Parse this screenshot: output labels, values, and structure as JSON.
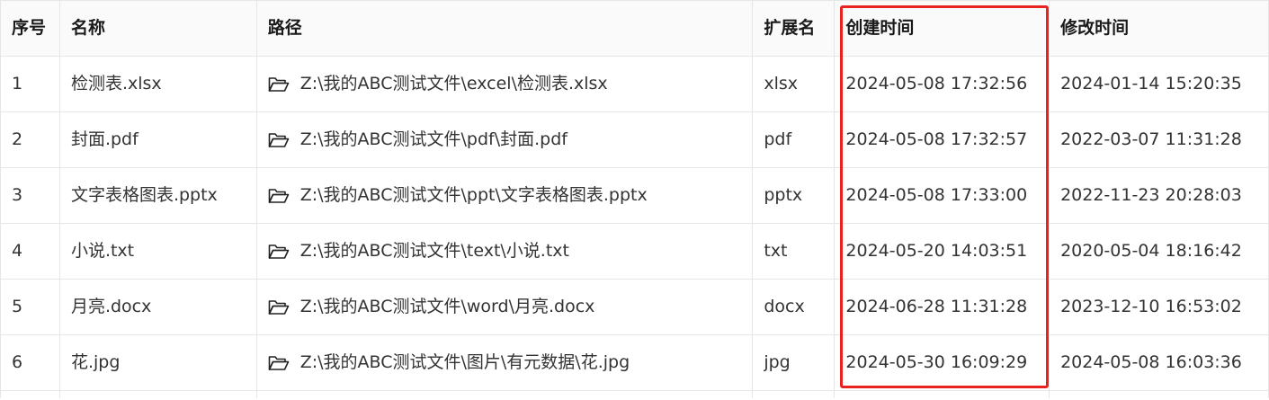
{
  "table": {
    "headers": {
      "index": "序号",
      "name": "名称",
      "path": "路径",
      "ext": "扩展名",
      "created": "创建时间",
      "modified": "修改时间"
    },
    "rows": [
      {
        "index": "1",
        "name": "检测表.xlsx",
        "path": "Z:\\我的ABC测试文件\\excel\\检测表.xlsx",
        "ext": "xlsx",
        "created": "2024-05-08 17:32:56",
        "modified": "2024-01-14 15:20:35"
      },
      {
        "index": "2",
        "name": "封面.pdf",
        "path": "Z:\\我的ABC测试文件\\pdf\\封面.pdf",
        "ext": "pdf",
        "created": "2024-05-08 17:32:57",
        "modified": "2022-03-07 11:31:28"
      },
      {
        "index": "3",
        "name": "文字表格图表.pptx",
        "path": "Z:\\我的ABC测试文件\\ppt\\文字表格图表.pptx",
        "ext": "pptx",
        "created": "2024-05-08 17:33:00",
        "modified": "2022-11-23 20:28:03"
      },
      {
        "index": "4",
        "name": "小说.txt",
        "path": "Z:\\我的ABC测试文件\\text\\小说.txt",
        "ext": "txt",
        "created": "2024-05-20 14:03:51",
        "modified": "2020-05-04 18:16:42"
      },
      {
        "index": "5",
        "name": "月亮.docx",
        "path": "Z:\\我的ABC测试文件\\word\\月亮.docx",
        "ext": "docx",
        "created": "2024-06-28 11:31:28",
        "modified": "2023-12-10 16:53:02"
      },
      {
        "index": "6",
        "name": "花.jpg",
        "path": "Z:\\我的ABC测试文件\\图片\\有元数据\\花.jpg",
        "ext": "jpg",
        "created": "2024-05-30 16:09:29",
        "modified": "2024-05-08 16:03:36"
      }
    ]
  },
  "icons": {
    "folder": "folder-open-icon"
  },
  "colors": {
    "highlight": "#e8231f",
    "border": "#e6e6e6"
  }
}
